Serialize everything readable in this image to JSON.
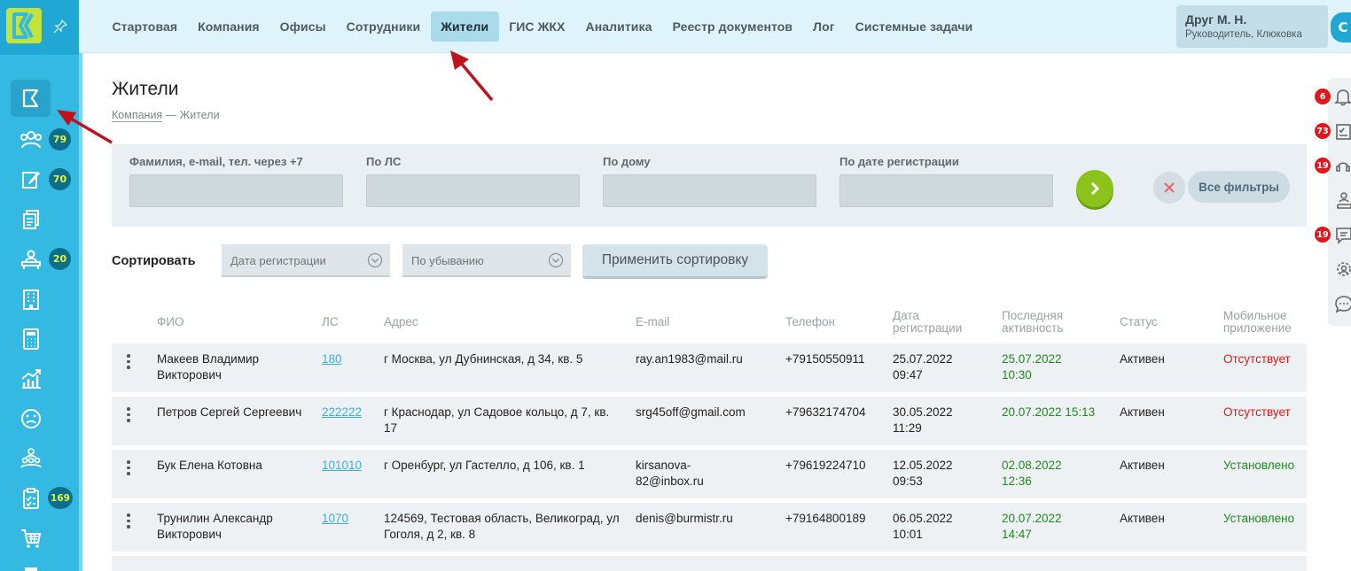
{
  "logo_text": "K",
  "sidebar": {
    "items": [
      {
        "icon": "flag-icon",
        "name": "sidebar-item-start",
        "badge": ""
      },
      {
        "icon": "residents-icon",
        "name": "sidebar-item-residents",
        "badge": "79"
      },
      {
        "icon": "edit-icon",
        "name": "sidebar-item-requests",
        "badge": "70"
      },
      {
        "icon": "documents-icon",
        "name": "sidebar-item-documents",
        "badge": ""
      },
      {
        "icon": "reception-icon",
        "name": "sidebar-item-reception",
        "badge": "20"
      },
      {
        "icon": "building-icon",
        "name": "sidebar-item-buildings",
        "badge": ""
      },
      {
        "icon": "calculator-icon",
        "name": "sidebar-item-calculator",
        "badge": ""
      },
      {
        "icon": "analytics-icon",
        "name": "sidebar-item-analytics",
        "badge": ""
      },
      {
        "icon": "sad-face-icon",
        "name": "sidebar-item-complaints",
        "badge": ""
      },
      {
        "icon": "team-icon",
        "name": "sidebar-item-team",
        "badge": ""
      },
      {
        "icon": "checklist-icon",
        "name": "sidebar-item-tasks",
        "badge": "169"
      },
      {
        "icon": "cart-icon",
        "name": "sidebar-item-shop",
        "badge": ""
      }
    ]
  },
  "topbar": {
    "menu": [
      "Стартовая",
      "Компания",
      "Офисы",
      "Сотрудники",
      "Жители",
      "ГИС ЖКХ",
      "Аналитика",
      "Реестр документов",
      "Лог",
      "Системные задачи"
    ],
    "active": "Жители",
    "user_name": "Друг М. Н.",
    "user_role": "Руководитель, Клюковка",
    "avatar_letter": "С"
  },
  "right_rail": {
    "badges": [
      "6",
      "73",
      "19",
      "19"
    ]
  },
  "page": {
    "title": "Жители",
    "breadcrumb_link": "Компания",
    "breadcrumb_sep": " — ",
    "breadcrumb_current": "Жители"
  },
  "filters": {
    "labels": [
      "Фамилия, e-mail, тел. через +7",
      "По ЛС",
      "По дому",
      "По дате регистрации"
    ],
    "values": [
      "",
      "",
      "",
      ""
    ],
    "all_filters": "Все фильтры"
  },
  "sort": {
    "label": "Сортировать",
    "field": "Дата регистрации",
    "order": "По убыванию",
    "apply": "Применить сортировку"
  },
  "table": {
    "headers": [
      "ФИО",
      "ЛС",
      "Адрес",
      "E-mail",
      "Телефон",
      "Дата регистрации",
      "Последняя активность",
      "Статус",
      "Мобильное приложение"
    ],
    "rows": [
      {
        "fio": "Макеев Владимир Викторович",
        "ls": "180",
        "address": "г Москва, ул Дубнинская, д 34, кв. 5",
        "email": "ray.an1983@mail.ru",
        "phone": "+79150550911",
        "reg": "25.07.2022 09:47",
        "activity": "25.07.2022 10:30",
        "status": "Активен",
        "mobile": "Отсутствует",
        "mobile_state": "absent"
      },
      {
        "fio": "Петров Сергей Сергеевич",
        "ls": "222222",
        "address": "г Краснодар, ул Садовое кольцо, д 7, кв. 17",
        "email": "srg45off@gmail.com",
        "phone": "+79632174704",
        "reg": "30.05.2022 11:29",
        "activity": "20.07.2022 15:13",
        "status": "Активен",
        "mobile": "Отсутствует",
        "mobile_state": "absent"
      },
      {
        "fio": "Бук Елена Котовна",
        "ls": "101010",
        "address": "г Оренбург, ул Гастелло, д 106, кв. 1",
        "email": "kirsanova-82@inbox.ru",
        "phone": "+79619224710",
        "reg": "12.05.2022 09:53",
        "activity": "02.08.2022 12:36",
        "status": "Активен",
        "mobile": "Установлено",
        "mobile_state": "installed"
      },
      {
        "fio": "Трунилин Александр Викторович",
        "ls": "1070",
        "address": "124569, Тестовая область, Великоград, ул Гоголя, д 2, кв. 8",
        "email": "denis@burmistr.ru",
        "phone": "+79164800189",
        "reg": "06.05.2022 10:01",
        "activity": "20.07.2022 14:47",
        "status": "Активен",
        "mobile": "Установлено",
        "mobile_state": "installed"
      }
    ]
  },
  "colors": {
    "sidebar": "#33b9e2",
    "topbar": "#dff3fb",
    "lime": "#c1e33b",
    "link": "#3ab1dc",
    "green": "#1f8a1f",
    "red": "#e01b1b",
    "arrow": "#c0121e"
  }
}
